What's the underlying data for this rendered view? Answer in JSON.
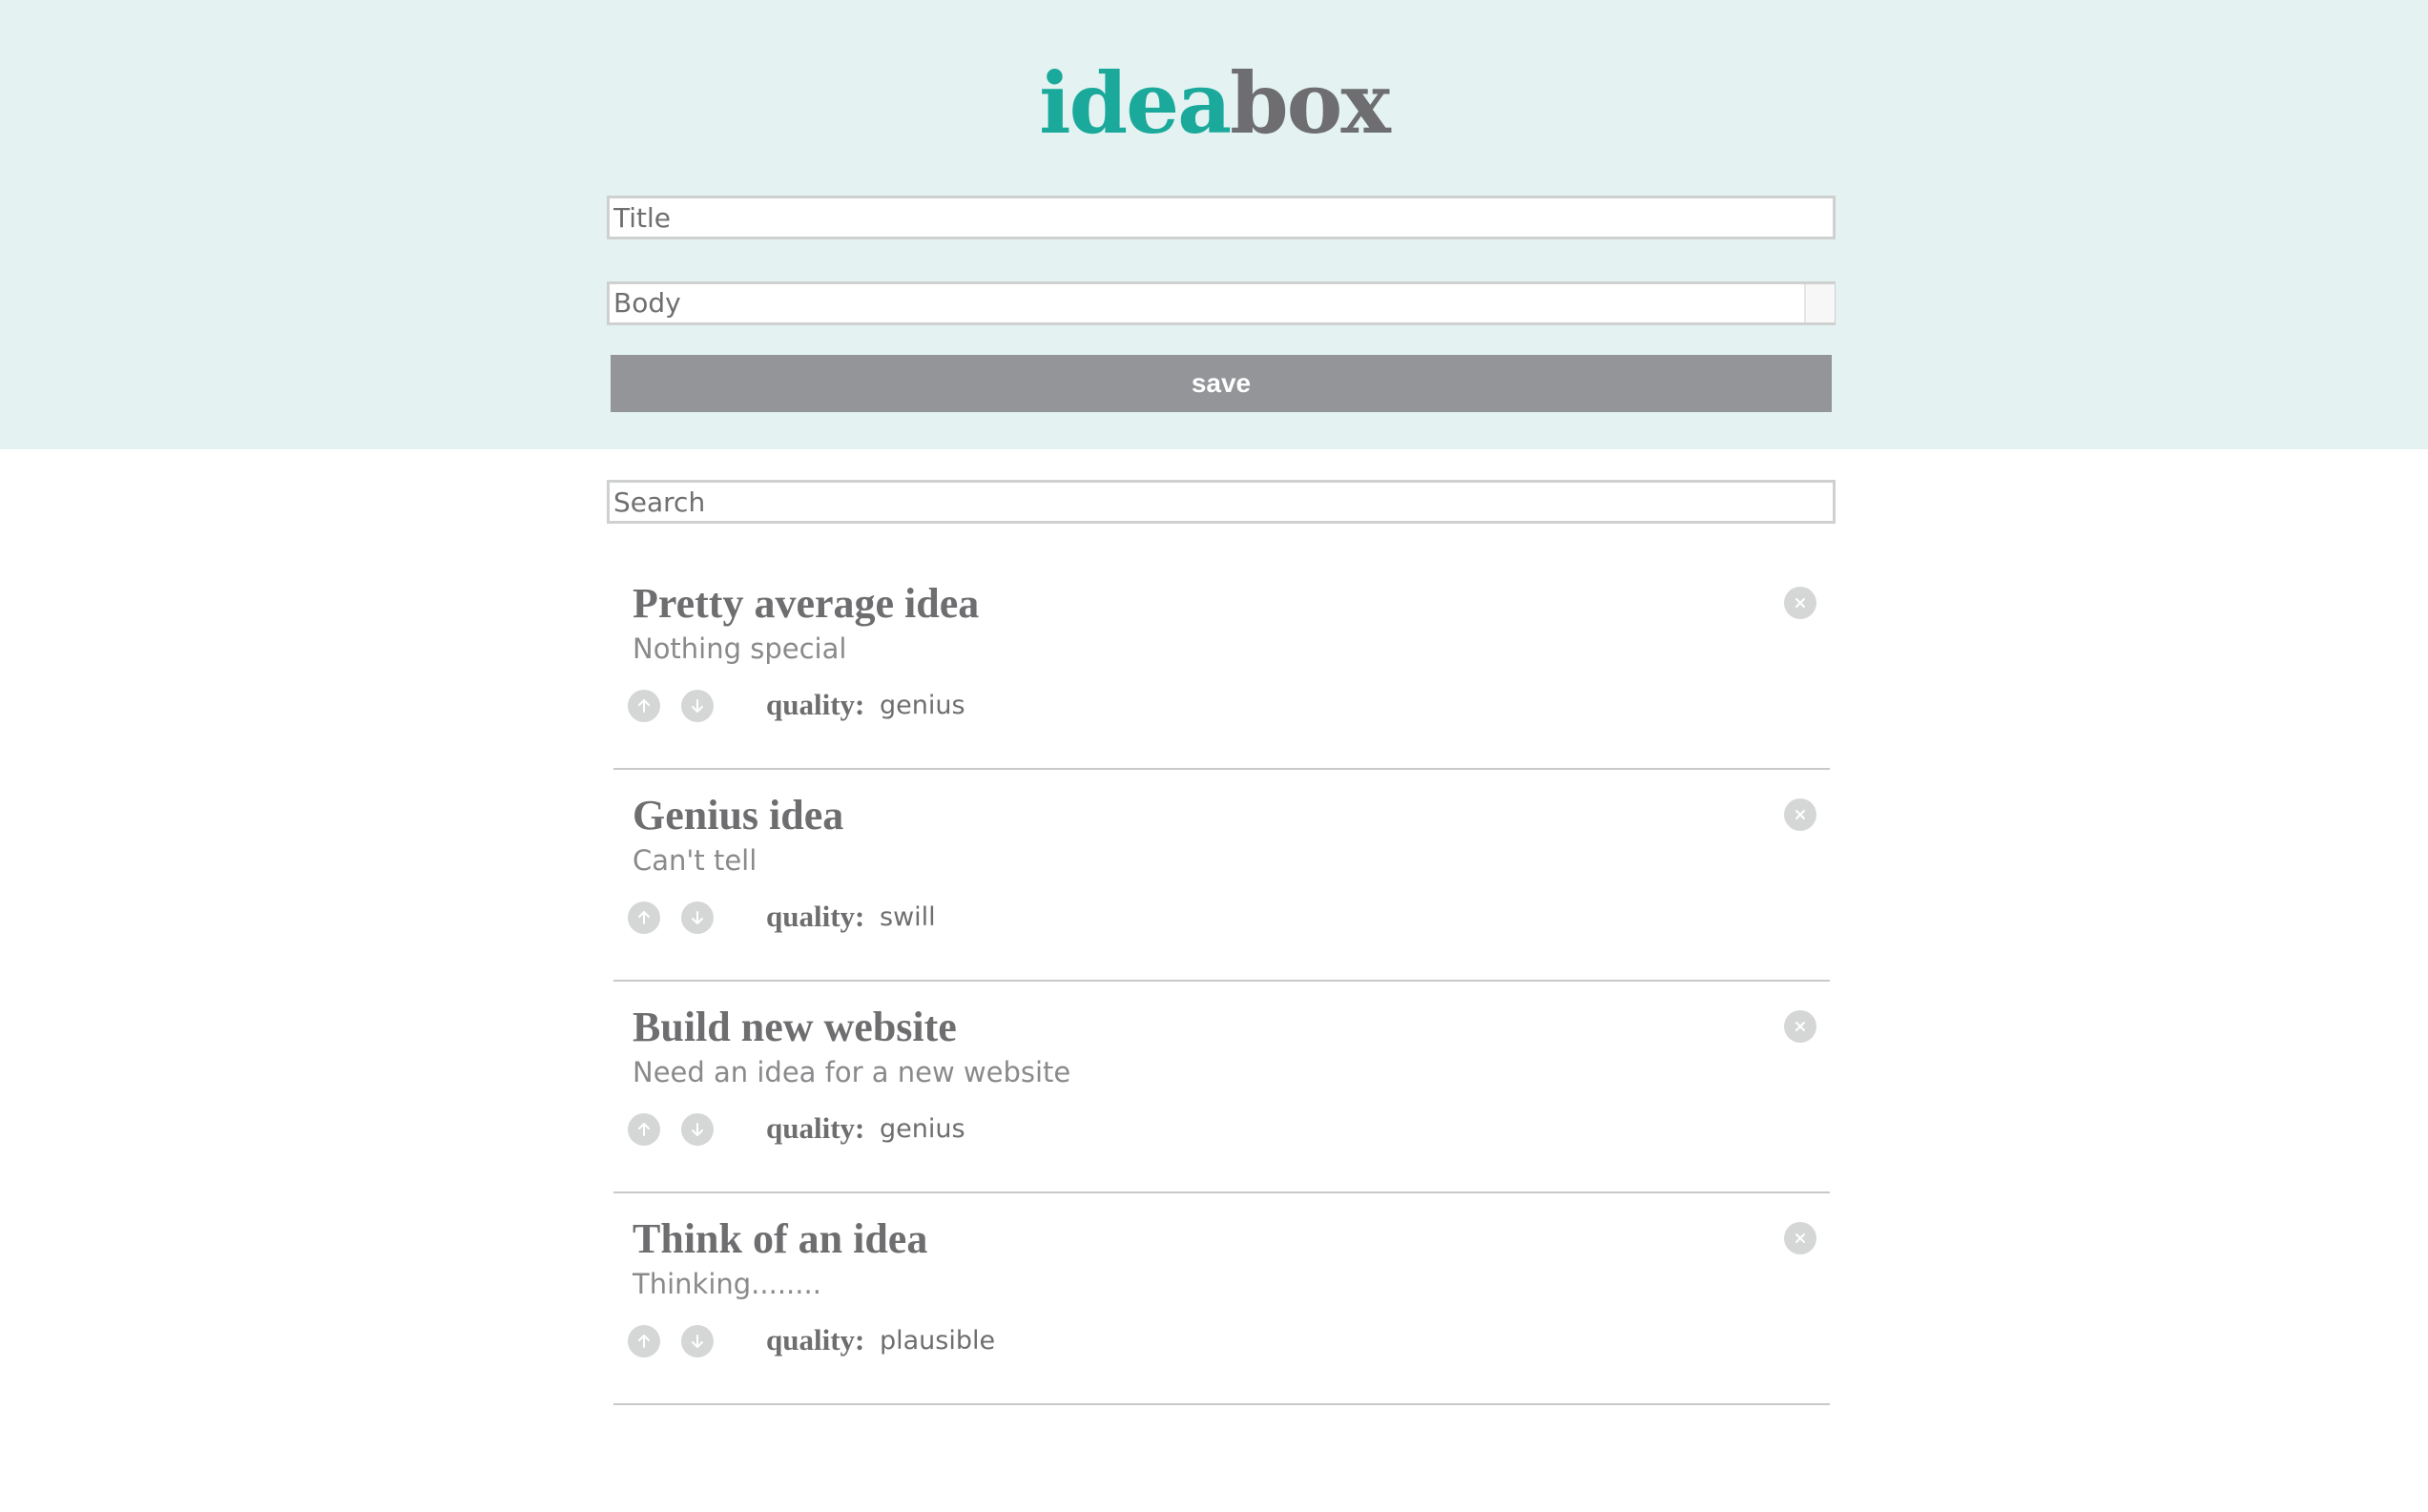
{
  "header": {
    "logo_part1": "idea",
    "logo_part2": "box",
    "logo_color_1": "#1aa99b",
    "logo_color_2": "#6e6e70",
    "background": "#e4f3f2"
  },
  "form": {
    "title_placeholder": "Title",
    "body_placeholder": "Body",
    "save_label": "save"
  },
  "search": {
    "placeholder": "Search"
  },
  "ideas": [
    {
      "title": "Pretty average idea",
      "body": "Nothing special",
      "quality_label": "quality:",
      "quality": "genius"
    },
    {
      "title": "Genius idea",
      "body": "Can't tell",
      "quality_label": "quality:",
      "quality": "swill"
    },
    {
      "title": "Build new website",
      "body": "Need an idea for a new website",
      "quality_label": "quality:",
      "quality": "genius"
    },
    {
      "title": "Think of an idea",
      "body": "Thinking........",
      "quality_label": "quality:",
      "quality": "plausible"
    }
  ],
  "icons": {
    "delete": "close-icon",
    "upvote": "arrow-up-icon",
    "downvote": "arrow-down-icon"
  }
}
